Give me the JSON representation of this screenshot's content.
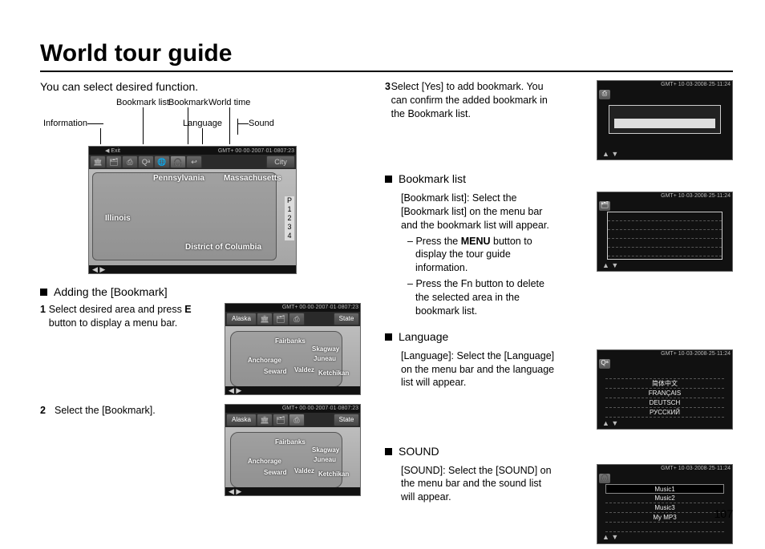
{
  "title": "World tour guide",
  "intro": "You can select desired function.",
  "page_number": "107",
  "icon_labels": {
    "information": "Information",
    "bookmark_list": "Bookmark list",
    "bookmark": "Bookmark",
    "language": "Language",
    "world_time": "World time",
    "sound": "Sound"
  },
  "main_map": {
    "topstrip": "GMT+ 00·00·2007·01·0807:23",
    "iconbar_tooltip": "Exit",
    "city_button": "City",
    "places": [
      "Pennsylvania",
      "Massachusetts",
      "Illinois",
      "District of Columbia"
    ],
    "side_nums": [
      "P",
      "1",
      "2",
      "3",
      "4"
    ],
    "arrows": "◀  ▶"
  },
  "left": {
    "adding_heading": "Adding the [Bookmark]",
    "step1": "Select desired area and press E button to display a menu bar.",
    "step2": "Select the [Bookmark].",
    "alaska_map": {
      "topstrip": "GMT+ 00·00·2007·01·0807:23",
      "left_btn": "Alaska",
      "right_btn": "State",
      "tooltip": "Bookmark",
      "places": [
        "Fairbanks",
        "Anchorage",
        "Seward",
        "Skagway",
        "Juneau",
        "Valdez",
        "Ketchikan"
      ]
    }
  },
  "right": {
    "step3_num": "3",
    "step3": "Select [Yes] to add bookmark. You can confirm the added bookmark in the Bookmark list.",
    "bookmark_list_heading": "Bookmark list",
    "bookmark_list_text": "[Bookmark list]: Select the [Bookmark list] on the menu bar and the bookmark list will appear.",
    "bookmark_list_dash1_a": "Press the ",
    "bookmark_list_dash1_b": "MENU",
    "bookmark_list_dash1_c": " button to display the tour guide information.",
    "bookmark_list_dash2": "Press the Fn button to delete the selected area in the bookmark list.",
    "language_heading": "Language",
    "language_text": "[Language]: Select the [Language] on the menu bar and the language list will appear.",
    "language_items": [
      "简体中文",
      "FRANÇAIS",
      "DEUTSCH",
      "РУССКИЙ"
    ],
    "sound_heading": "SOUND",
    "sound_text": "[SOUND]: Select the [SOUND] on the menu bar and the sound list will appear.",
    "sound_items": [
      "Music1",
      "Music2",
      "Music3",
      "My MP3"
    ],
    "shot_topstrip": "GMT+ 10·03·2008·25·11:24",
    "ud_arrows": "▲  ▼"
  }
}
